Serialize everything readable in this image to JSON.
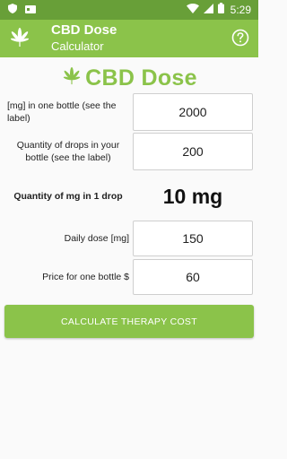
{
  "status_bar": {
    "time": "5:29"
  },
  "app_bar": {
    "title": "CBD Dose",
    "subtitle": "Calculator"
  },
  "brand": {
    "title": "CBD Dose"
  },
  "form": {
    "mg_label": "[mg] in one bottle (see the label)",
    "mg_value": "2000",
    "drops_label": "Quantity of drops in your bottle (see the label)",
    "drops_value": "200",
    "result_label": "Quantity of mg in 1 drop",
    "result_value": "10 mg",
    "daily_label": "Daily dose [mg]",
    "daily_value": "150",
    "price_label": "Price for one bottle $",
    "price_value": "60"
  },
  "calculate_button": {
    "label": "CALCULATE THERAPY COST"
  },
  "colors": {
    "primary": "#8bc34a",
    "primary_dark": "#689f38"
  },
  "icons": [
    "shield-icon",
    "card-icon",
    "wifi-icon",
    "signal-icon",
    "battery-icon",
    "cannabis-leaf-icon",
    "help-icon"
  ]
}
